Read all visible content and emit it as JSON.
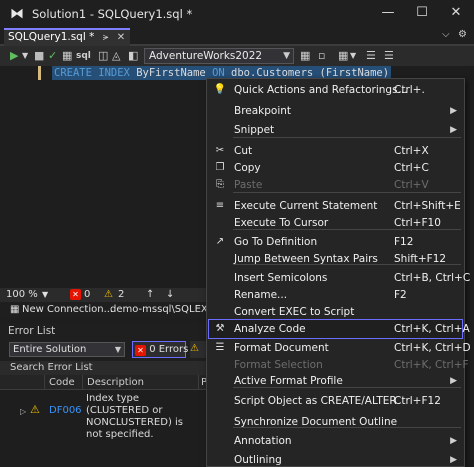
{
  "titlebar": {
    "title": "Solution1 - SQLQuery1.sql *",
    "minimize": "—",
    "maximize": "☐",
    "close": "✕"
  },
  "doc_tab": {
    "label": "SQLQuery1.sql *",
    "pin": "⪫",
    "close": "✕",
    "overflow": "⌵",
    "settings": "⚙"
  },
  "toolbar": {
    "database": "AdventureWorks2022"
  },
  "editor": {
    "tokens": [
      {
        "text": "CREATE",
        "kind": "kw"
      },
      {
        "text": " ",
        "kind": "id"
      },
      {
        "text": "INDEX",
        "kind": "kw"
      },
      {
        "text": " ByFirstName ",
        "kind": "id"
      },
      {
        "text": "ON",
        "kind": "kw"
      },
      {
        "text": " dbo.Customers (FirstName)",
        "kind": "id"
      }
    ]
  },
  "status": {
    "zoom": "100 %",
    "errors": "0",
    "warnings": "2"
  },
  "open_tabs": {
    "new_connection": "New Connection...",
    "server": "demo-mssql\\SQLEXPR"
  },
  "error_list": {
    "title": "Error List",
    "scope": "Entire Solution",
    "errors_label": "0 Errors",
    "search": "Search Error List",
    "columns": [
      "Code",
      "Description",
      "P"
    ],
    "rows": [
      {
        "code": "DF006",
        "description": "Index type (CLUSTERED or NONCLUSTERED) is not specified."
      }
    ]
  },
  "context_menu": {
    "items": [
      {
        "label": "Quick Actions and Refactorings...",
        "shortcut": "Ctrl+.",
        "icon": "lightbulb-icon",
        "glyph": "💡"
      },
      {
        "label": "Breakpoint",
        "shortcut": "",
        "submenu": true
      },
      {
        "label": "Snippet",
        "shortcut": "",
        "submenu": true
      },
      {
        "label": "Cut",
        "shortcut": "Ctrl+X",
        "icon": "scissors-icon",
        "glyph": "✂"
      },
      {
        "label": "Copy",
        "shortcut": "Ctrl+C",
        "icon": "copy-icon",
        "glyph": "❐"
      },
      {
        "label": "Paste",
        "shortcut": "Ctrl+V",
        "icon": "paste-icon",
        "glyph": "⎘",
        "disabled": true
      },
      {
        "label": "Execute Current Statement",
        "shortcut": "Ctrl+Shift+E",
        "icon": "execute-statement-icon",
        "glyph": "≡"
      },
      {
        "label": "Execute To Cursor",
        "shortcut": "Ctrl+F10"
      },
      {
        "label": "Go To Definition",
        "shortcut": "F12",
        "icon": "go-to-definition-icon",
        "glyph": "↗"
      },
      {
        "label": "Jump Between Syntax Pairs",
        "shortcut": "Shift+F12"
      },
      {
        "label": "Insert Semicolons",
        "shortcut": "Ctrl+B, Ctrl+C"
      },
      {
        "label": "Rename...",
        "shortcut": "F2"
      },
      {
        "label": "Convert EXEC to Script",
        "shortcut": ""
      },
      {
        "label": "Analyze Code",
        "shortcut": "Ctrl+K, Ctrl+A",
        "icon": "analyze-code-icon",
        "glyph": "⚒",
        "highlighted": true
      },
      {
        "label": "Format Document",
        "shortcut": "Ctrl+K, Ctrl+D",
        "icon": "format-document-icon",
        "glyph": "☰"
      },
      {
        "label": "Format Selection",
        "shortcut": "Ctrl+K, Ctrl+F",
        "disabled": true
      },
      {
        "label": "Active Format Profile",
        "shortcut": "",
        "submenu": true
      },
      {
        "label": "Script Object as CREATE/ALTER",
        "shortcut": "Ctrl+F12"
      },
      {
        "label": "Synchronize Document Outline",
        "shortcut": ""
      },
      {
        "label": "Annotation",
        "shortcut": "",
        "submenu": true
      },
      {
        "label": "Outlining",
        "shortcut": "",
        "submenu": true
      }
    ]
  }
}
